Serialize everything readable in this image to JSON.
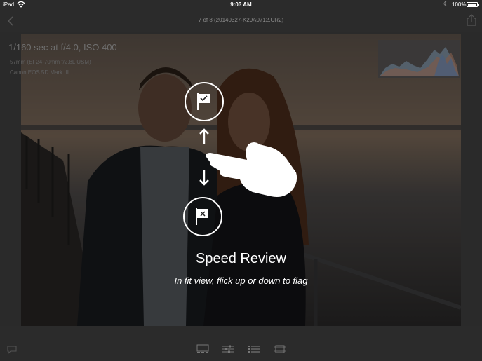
{
  "status_bar": {
    "device": "iPad",
    "time": "9:03 AM",
    "battery": "100%"
  },
  "header": {
    "title": "7 of 8 (20140327-K29A0712.CR2)"
  },
  "photo_info": {
    "exposure": "1/160 sec at f/4.0, ISO 400",
    "lens": "57mm (EF24-70mm f/2.8L USM)",
    "camera": "Canon EOS 5D Mark III"
  },
  "overlay": {
    "title": "Speed Review",
    "subtitle": "In fit view, flick up or down to flag"
  },
  "icons": {
    "back": "chevron-left-icon",
    "share": "share-icon",
    "flag_pick": "flag-pick-icon",
    "flag_reject": "flag-reject-icon",
    "comment": "comment-icon",
    "filmstrip": "filmstrip-icon",
    "adjust": "sliders-icon",
    "list": "list-icon",
    "crop": "crop-icon"
  },
  "colors": {
    "bar_background": "#2b2b2b",
    "overlay_text": "#ffffff"
  }
}
